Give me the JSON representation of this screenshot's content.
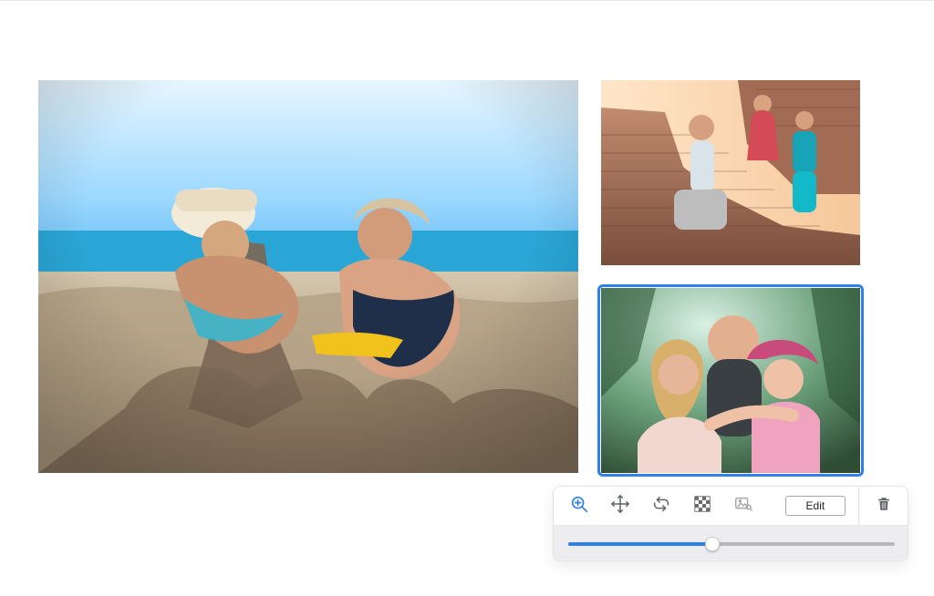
{
  "toolbar": {
    "icons": {
      "zoom": "zoom-in-icon",
      "move": "move-icon",
      "rotate": "rotate-icon",
      "transparency": "transparency-icon",
      "replace": "image-search-icon",
      "delete": "trash-icon"
    },
    "edit_label": "Edit",
    "zoom_slider": {
      "value": 0.44
    }
  },
  "colors": {
    "accent": "#2f80ed"
  }
}
